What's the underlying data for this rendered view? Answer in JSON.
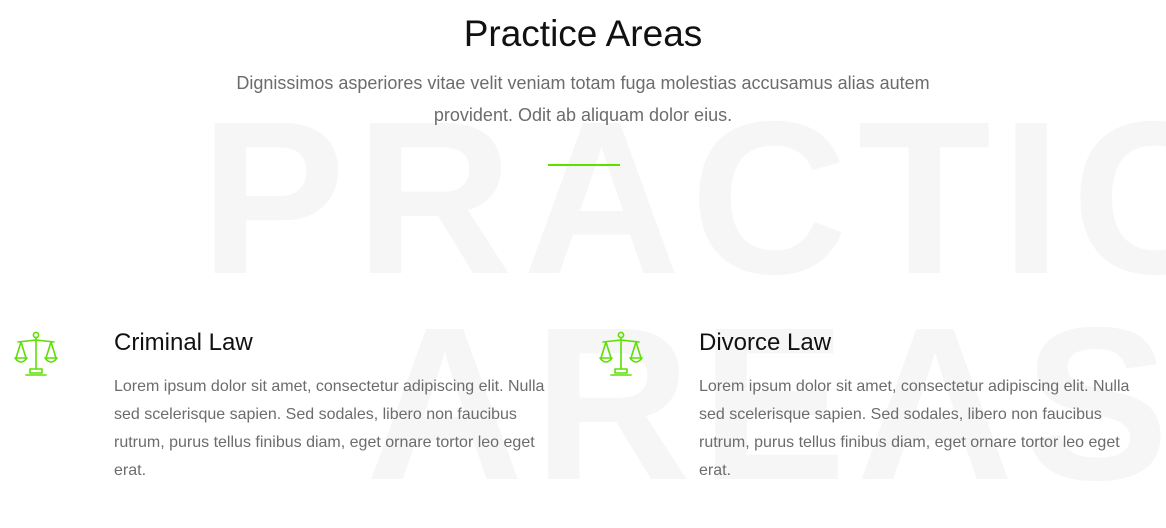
{
  "section": {
    "watermark": [
      "PRACTICE",
      "AREAS"
    ],
    "title": "Practice Areas",
    "subtitle": "Dignissimos asperiores vitae velit veniam totam fuga molestias accusamus alias autem provident. Odit ab aliquam dolor eius.",
    "accent_color": "#5ce000"
  },
  "practice_areas": [
    {
      "icon": "scales-of-justice-icon",
      "title": "Criminal Law",
      "description": "Lorem ipsum dolor sit amet, consectetur adipiscing elit. Nulla sed scelerisque sapien. Sed sodales, libero non faucibus rutrum, purus tellus finibus diam, eget ornare tortor leo eget erat."
    },
    {
      "icon": "scales-of-justice-icon",
      "title": "Divorce Law",
      "description": "Lorem ipsum dolor sit amet, consectetur adipiscing elit. Nulla sed scelerisque sapien. Sed sodales, libero non faucibus rutrum, purus tellus finibus diam, eget ornare tortor leo eget erat."
    }
  ]
}
